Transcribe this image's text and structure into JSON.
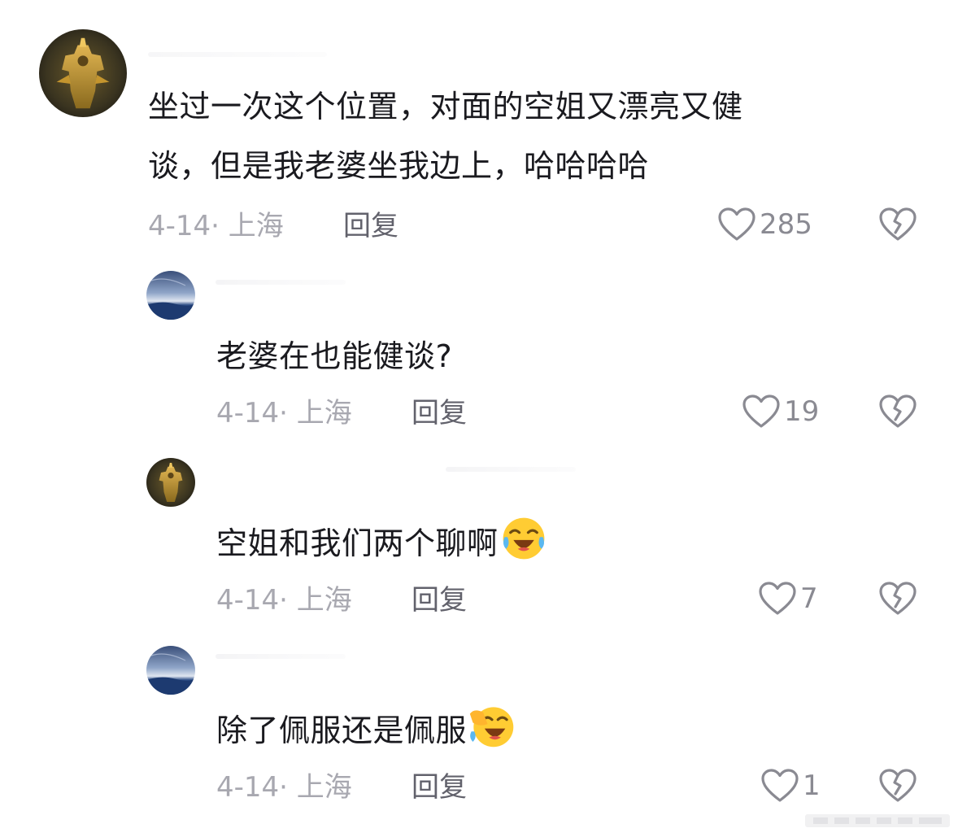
{
  "comments": [
    {
      "text_lines": [
        "坐过一次这个位置，对面的空姐又漂亮又健",
        "谈，但是我老婆坐我边上，哈哈哈哈"
      ],
      "date": "4-14",
      "separator": "·",
      "location": "上海",
      "reply_label": "回复",
      "likes": "285",
      "avatar": "gold-armor-avatar"
    },
    {
      "text": "老婆在也能健谈?",
      "date": "4-14",
      "separator": "·",
      "location": "上海",
      "reply_label": "回复",
      "likes": "19",
      "avatar": "night-sky-avatar"
    },
    {
      "text": "空姐和我们两个聊啊",
      "emoji": "crying-laughing-emoji",
      "date": "4-14",
      "separator": "·",
      "location": "上海",
      "reply_label": "回复",
      "likes": "7",
      "avatar": "gold-armor-avatar"
    },
    {
      "text": "除了佩服还是佩服",
      "emoji": "tears-of-joy-emoji",
      "date": "4-14",
      "separator": "·",
      "location": "上海",
      "reply_label": "回复",
      "likes": "1",
      "avatar": "night-sky-avatar"
    }
  ],
  "colors": {
    "text": "#1a1a1f",
    "meta": "#a8a8b0",
    "reply": "#62626c",
    "icon": "#8a8a92"
  }
}
